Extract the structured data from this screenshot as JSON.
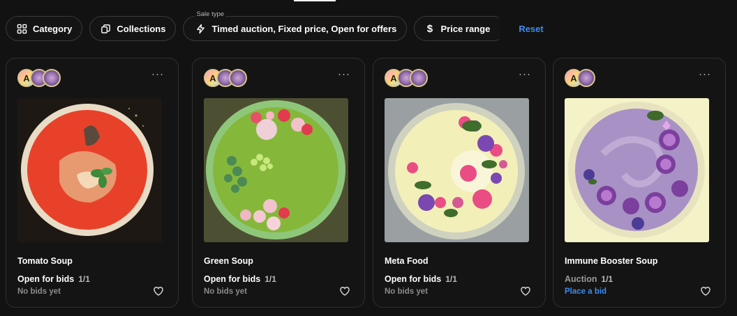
{
  "filters": {
    "category_label": "Category",
    "collections_label": "Collections",
    "sale_type_caption": "Sale type",
    "sale_type_value": "Timed auction, Fixed price, Open for offers",
    "price_range_label": "Price range",
    "reset_label": "Reset"
  },
  "cards": [
    {
      "title": "Tomato Soup",
      "sale_status": "Open for bids",
      "edition": "1/1",
      "bid_info": "No bids yet",
      "menu": "···"
    },
    {
      "title": "Green Soup",
      "sale_status": "Open for bids",
      "edition": "1/1",
      "bid_info": "No bids yet",
      "menu": "···"
    },
    {
      "title": "Meta Food",
      "sale_status": "Open for bids",
      "edition": "1/1",
      "bid_info": "No bids yet",
      "menu": "···"
    },
    {
      "title": "Immune Booster Soup",
      "sale_status": "Auction",
      "edition": "1/1",
      "bid_info": "Place a bid",
      "menu": "···"
    }
  ],
  "colors": {
    "accent": "#3b8cf0",
    "background": "#121212",
    "card_border": "#303030"
  },
  "icons": [
    "category-grid-icon",
    "collections-icon",
    "lightning-icon",
    "dollar-icon",
    "more-dots-icon",
    "heart-icon"
  ]
}
